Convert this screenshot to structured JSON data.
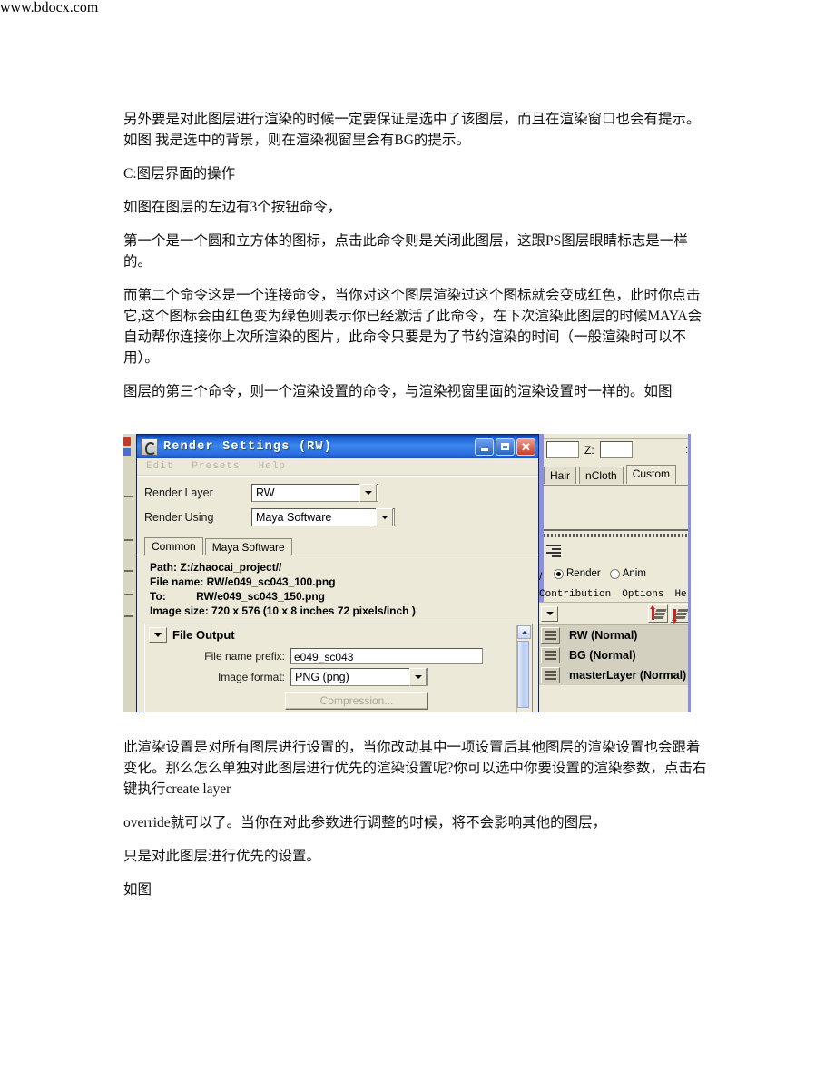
{
  "document": {
    "paragraphs": [
      "另外要是对此图层进行渲染的时候一定要保证是选中了该图层，而且在渲染窗口也会有提示。如图 我是选中的背景，则在渲染视窗里会有BG的提示。",
      "C:图层界面的操作",
      " 如图在图层的左边有3个按钮命令，",
      "第一个是一个圆和立方体的图标，点击此命令则是关闭此图层，这跟PS图层眼睛标志是一样的。",
      "而第二个命令这是一个连接命令，当你对这个图层渲染过这个图标就会变成红色，此时你点击它,这个图标会由红色变为绿色则表示你已经激活了此命令，在下次渲染此图层的时候MAYA会自动帮你连接你上次所渲染的图片，此命令只要是为了节约渲染的时间（一般渲染时可以不用）。",
      "图层的第三个命令，则一个渲染设置的命令，与渲染视窗里面的渲染设置时一样的。如图"
    ],
    "paragraphs_after": [
      "此渲染设置是对所有图层进行设置的，当你改动其中一项设置后其他图层的渲染设置也会跟着变化。那么怎么单独对此图层进行优先的渲染设置呢?你可以选中你要设置的渲染参数，点击右键执行create layer",
      "override就可以了。当你在对此参数进行调整的时候，将不会影响其他的图层，",
      "只是对此图层进行优先的设置。",
      "如图"
    ]
  },
  "screenshot": {
    "watermark": "www.bdocx.com",
    "render_settings": {
      "title": "Render Settings (RW)",
      "window_icon": "maya-render-icon",
      "buttons": {
        "minimize": "minimize-button",
        "maximize": "maximize-button",
        "close": "close-button"
      },
      "menus": [
        "Edit",
        "Presets",
        "Help"
      ],
      "fields": [
        {
          "label": "Render Layer",
          "value": "RW"
        },
        {
          "label": "Render Using",
          "value": "Maya Software"
        }
      ],
      "tabs": [
        {
          "label": "Common",
          "active": true
        },
        {
          "label": "Maya Software",
          "active": false
        }
      ],
      "info": [
        "Path: Z:/zhaocai_project//",
        "File name: RW/e049_sc043_100.png",
        "To:          RW/e049_sc043_150.png",
        "Image size: 720 x 576 (10 x 8 inches 72 pixels/inch )"
      ],
      "file_output": {
        "section_title": "File Output",
        "prefix_label": "File name prefix:",
        "prefix_value": "e049_sc043",
        "format_label": "Image format:",
        "format_value": "PNG (png)",
        "compression_button": "Compression..."
      }
    },
    "right_panel": {
      "z_label": "Z:",
      "tabs": [
        {
          "label": "Hair",
          "active": false
        },
        {
          "label": "nCloth",
          "active": false
        },
        {
          "label": "Custom",
          "active": true
        }
      ],
      "mode_radios": [
        {
          "label": "Render",
          "selected": true
        },
        {
          "label": "Anim",
          "selected": false
        }
      ],
      "menus": [
        "Contribution",
        "Options",
        "Help"
      ],
      "layers": [
        "RW (Normal)",
        "BG (Normal)",
        "masterLayer (Normal)"
      ]
    }
  },
  "colors": {
    "title_bar_blue": "#1e63d6",
    "window_face": "#ece9d8",
    "close_red": "#c4402c",
    "accent_purple": "#8a8fe0",
    "list_bg": "#d4d0c0"
  }
}
